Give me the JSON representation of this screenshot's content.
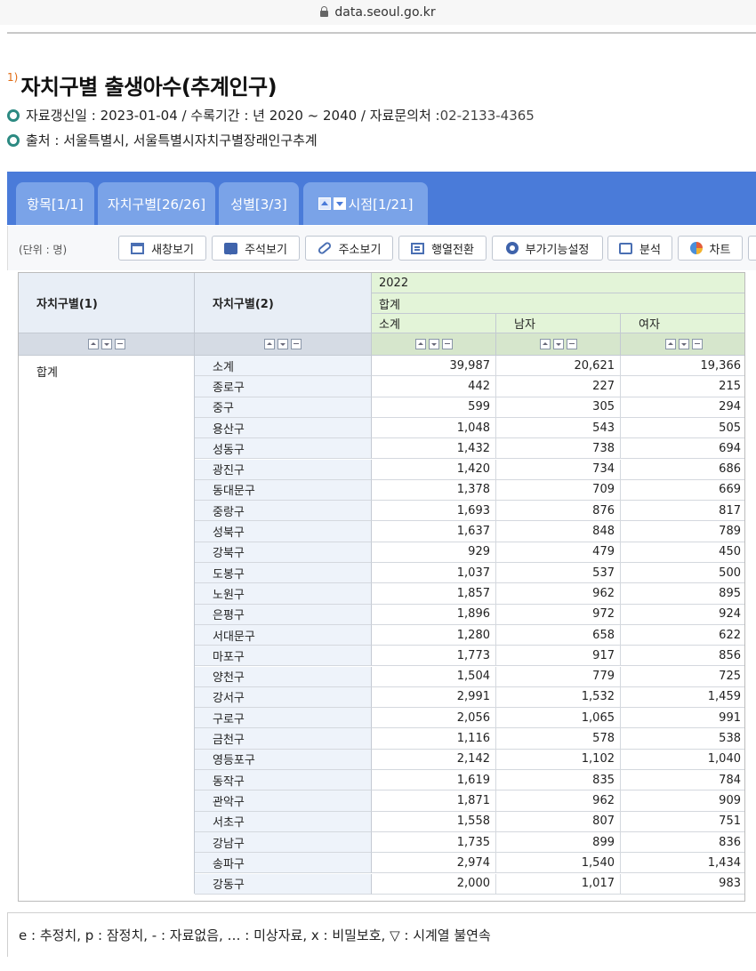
{
  "browser": {
    "url": "data.seoul.go.kr"
  },
  "page": {
    "title_marker": "1)",
    "title": "자치구별 출생아수(추계인구)",
    "meta1_label": "자료갱신일 : 2023-01-04 / 수록기간 : 년 2020 ~ 2040 / 자료문의처 : ",
    "meta1_phone": "02-2133-4365",
    "meta2": "출처 : 서울특별시, 서울특별시자치구별장래인구추계"
  },
  "tabs": [
    "항목[1/1]",
    "자치구별[26/26]",
    "성별[3/3]",
    "시점[1/21]"
  ],
  "toolbar": {
    "unit": "(단위 : 명)",
    "buttons": [
      "새창보기",
      "주석보기",
      "주소보기",
      "행열전환",
      "부가기능설정",
      "분석",
      "차트"
    ]
  },
  "table": {
    "col1_header": "자치구별(1)",
    "col2_header": "자치구별(2)",
    "year": "2022",
    "group": "합계",
    "sub_headers": [
      "소계",
      "남자",
      "여자"
    ],
    "group_label": "합계",
    "rows": [
      {
        "name": "소계",
        "total": "39,987",
        "male": "20,621",
        "female": "19,366"
      },
      {
        "name": "종로구",
        "total": "442",
        "male": "227",
        "female": "215"
      },
      {
        "name": "중구",
        "total": "599",
        "male": "305",
        "female": "294"
      },
      {
        "name": "용산구",
        "total": "1,048",
        "male": "543",
        "female": "505"
      },
      {
        "name": "성동구",
        "total": "1,432",
        "male": "738",
        "female": "694"
      },
      {
        "name": "광진구",
        "total": "1,420",
        "male": "734",
        "female": "686"
      },
      {
        "name": "동대문구",
        "total": "1,378",
        "male": "709",
        "female": "669"
      },
      {
        "name": "중랑구",
        "total": "1,693",
        "male": "876",
        "female": "817"
      },
      {
        "name": "성북구",
        "total": "1,637",
        "male": "848",
        "female": "789"
      },
      {
        "name": "강북구",
        "total": "929",
        "male": "479",
        "female": "450"
      },
      {
        "name": "도봉구",
        "total": "1,037",
        "male": "537",
        "female": "500"
      },
      {
        "name": "노원구",
        "total": "1,857",
        "male": "962",
        "female": "895"
      },
      {
        "name": "은평구",
        "total": "1,896",
        "male": "972",
        "female": "924"
      },
      {
        "name": "서대문구",
        "total": "1,280",
        "male": "658",
        "female": "622"
      },
      {
        "name": "마포구",
        "total": "1,773",
        "male": "917",
        "female": "856"
      },
      {
        "name": "양천구",
        "total": "1,504",
        "male": "779",
        "female": "725"
      },
      {
        "name": "강서구",
        "total": "2,991",
        "male": "1,532",
        "female": "1,459"
      },
      {
        "name": "구로구",
        "total": "2,056",
        "male": "1,065",
        "female": "991"
      },
      {
        "name": "금천구",
        "total": "1,116",
        "male": "578",
        "female": "538"
      },
      {
        "name": "영등포구",
        "total": "2,142",
        "male": "1,102",
        "female": "1,040"
      },
      {
        "name": "동작구",
        "total": "1,619",
        "male": "835",
        "female": "784"
      },
      {
        "name": "관악구",
        "total": "1,871",
        "male": "962",
        "female": "909"
      },
      {
        "name": "서초구",
        "total": "1,558",
        "male": "807",
        "female": "751"
      },
      {
        "name": "강남구",
        "total": "1,735",
        "male": "899",
        "female": "836"
      },
      {
        "name": "송파구",
        "total": "2,974",
        "male": "1,540",
        "female": "1,434"
      },
      {
        "name": "강동구",
        "total": "2,000",
        "male": "1,017",
        "female": "983"
      }
    ]
  },
  "footer": {
    "legend": "e : 추정치, p : 잠정치, - : 자료없음, … : 미상자료, x : 비밀보호, ▽ : 시계열 불연속"
  }
}
